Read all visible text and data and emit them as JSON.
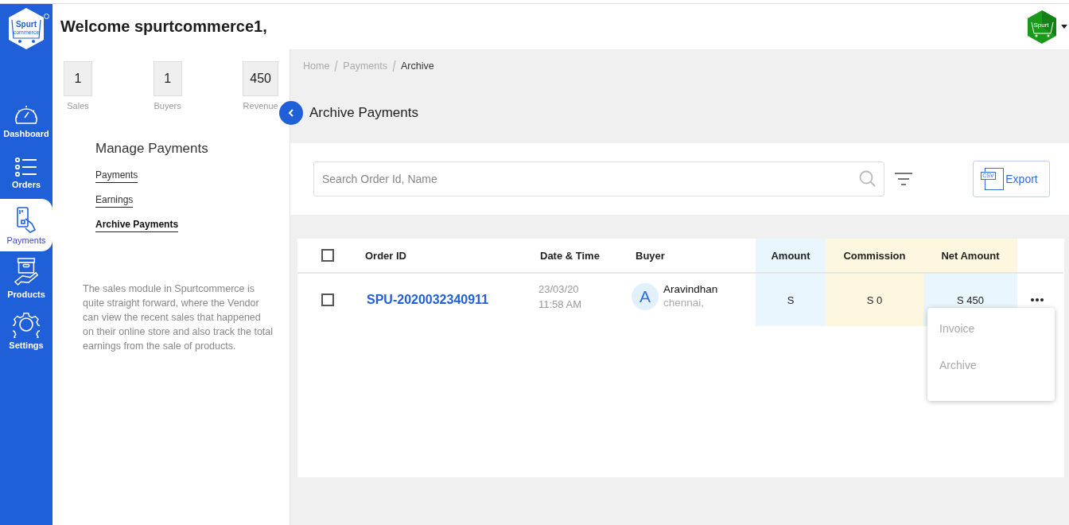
{
  "header": {
    "logo": {
      "text": "Spurt",
      "subtext": "commerce"
    },
    "welcome": "Welcome spurtcommerce1,",
    "avatar": {
      "text": "Spurt"
    }
  },
  "sidebar": {
    "items": [
      {
        "label": "Dashboard",
        "kind": "dashboard",
        "selected": false
      },
      {
        "label": "Orders",
        "kind": "orders",
        "selected": false
      },
      {
        "label": "Payments",
        "kind": "payments",
        "selected": true
      },
      {
        "label": "Products",
        "kind": "products",
        "selected": false
      },
      {
        "label": "Settings",
        "kind": "settings",
        "selected": false
      }
    ]
  },
  "stats": [
    {
      "value": "1",
      "label": "Sales"
    },
    {
      "value": "1",
      "label": "Buyers"
    },
    {
      "value": "450",
      "label": "Revenue"
    }
  ],
  "manage": {
    "title": "Manage Payments",
    "links": [
      {
        "label": "Payments",
        "selected": false
      },
      {
        "label": "Earnings",
        "selected": false
      },
      {
        "label": "Archive Payments",
        "selected": true
      }
    ]
  },
  "description": "The sales module in Spurtcommerce is quite straight forward, where the Vendor can view the recent sales that happened on their online store and also track the total earnings from the sale of products.",
  "breadcrumb": [
    {
      "label": "Home",
      "selected": false
    },
    {
      "label": "Payments",
      "selected": false
    },
    {
      "label": "Archive",
      "selected": true
    }
  ],
  "page_title": "Archive Payments",
  "search": {
    "placeholder": "Search Order Id, Name"
  },
  "export": {
    "label": "Export",
    "icon_text": "CSV"
  },
  "table": {
    "select_all": {
      "checked": false
    },
    "columns": [
      "Order ID",
      "Date & Time",
      "Buyer",
      "Amount",
      "Commission",
      "Net Amount"
    ],
    "rows": [
      {
        "checked": false,
        "order_id": "SPU-2020032340911",
        "date": "23/03/20",
        "time": "11:58 AM",
        "buyer": {
          "initial": "A",
          "name": "Aravindhan",
          "city": "chennai,"
        },
        "amount": "S",
        "commission": "S 0",
        "net_amount": "S 450"
      }
    ]
  },
  "row_menu": {
    "items": [
      "Invoice",
      "Archive"
    ]
  }
}
